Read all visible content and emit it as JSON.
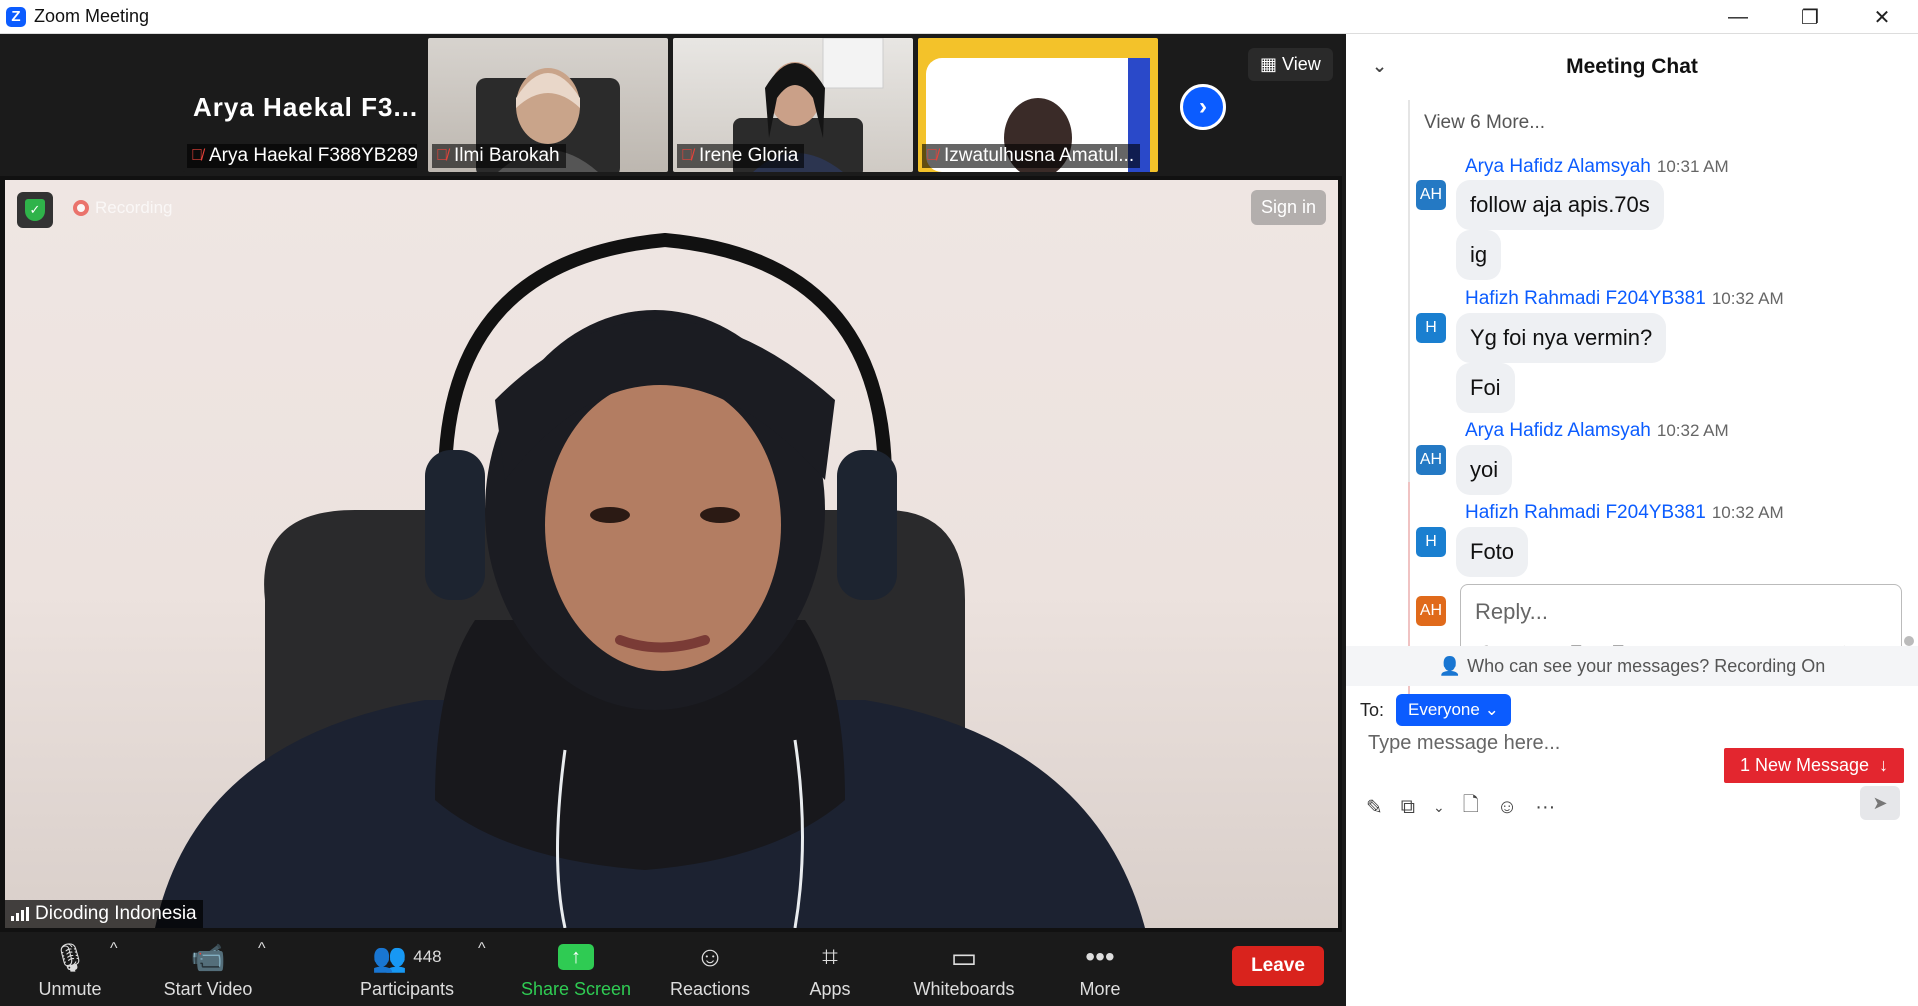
{
  "window": {
    "title": "Zoom Meeting",
    "min": "—",
    "max": "❐",
    "close": "✕"
  },
  "strip": {
    "featured_big": "Arya Haekal F3...",
    "tiles": [
      {
        "name": "Arya Haekal F388YB289"
      },
      {
        "name": "Ilmi Barokah"
      },
      {
        "name": "Irene Gloria"
      },
      {
        "name": "Izwatulhusna Amatul..."
      }
    ],
    "view_label": "View"
  },
  "main": {
    "recording_label": "Recording",
    "signin_label": "Sign in",
    "speaker_name": "Dicoding Indonesia"
  },
  "toolbar": {
    "unmute": "Unmute",
    "start_video": "Start Video",
    "participants": "Participants",
    "participants_count": "448",
    "share_screen": "Share Screen",
    "reactions": "Reactions",
    "apps": "Apps",
    "whiteboards": "Whiteboards",
    "more": "More",
    "leave": "Leave"
  },
  "chat": {
    "title": "Meeting Chat",
    "view_more": "View 6 More...",
    "messages": [
      {
        "sender": "Arya Hafidz Alamsyah",
        "time": "10:31 AM",
        "initials": "AH",
        "lines": [
          "follow aja apis.70s",
          "ig"
        ]
      },
      {
        "sender": "Hafizh Rahmadi F204YB381",
        "time": "10:32 AM",
        "initials": "H",
        "lines": [
          "Yg foi nya vermin?",
          "Foi"
        ]
      },
      {
        "sender": "Arya Hafidz Alamsyah",
        "time": "10:32 AM",
        "initials": "AH",
        "lines": [
          "yoi"
        ]
      },
      {
        "sender": "Hafizh Rahmadi F204YB381",
        "time": "10:32 AM",
        "initials": "H",
        "lines": [
          "Foto"
        ]
      }
    ],
    "reply_avatar": "AH",
    "reply_placeholder": "Reply...",
    "new_message": "1 New Message",
    "privacy": "Who can see your messages? Recording On",
    "to_label": "To:",
    "to_value": "Everyone",
    "input_placeholder": "Type message here..."
  },
  "colors": {
    "accent": "#0b5cff",
    "leave": "#d9231d",
    "recording": "#e8433a"
  }
}
